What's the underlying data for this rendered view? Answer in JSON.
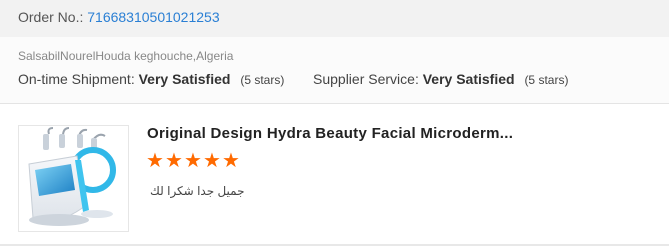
{
  "order": {
    "label": "Order No.:",
    "number": "71668310501021253"
  },
  "feedback": {
    "buyer": "SalsabilNourelHouda keghouche,Algeria",
    "ratings": [
      {
        "label": "On-time Shipment:",
        "value": "Very Satisfied",
        "stars_text": "(5 stars)"
      },
      {
        "label": "Supplier Service:",
        "value": "Very Satisfied",
        "stars_text": "(5 stars)"
      }
    ]
  },
  "product": {
    "title": "Original Design Hydra Beauty Facial Microderm...",
    "rating": 5,
    "max_rating": 5,
    "comment": "جميل جدا شكرا لك",
    "image_icon": "facial-machine-image"
  },
  "colors": {
    "accent_link": "#2a7fd4",
    "star": "#ff6a00",
    "order_bar_bg": "#f2f2f2"
  }
}
